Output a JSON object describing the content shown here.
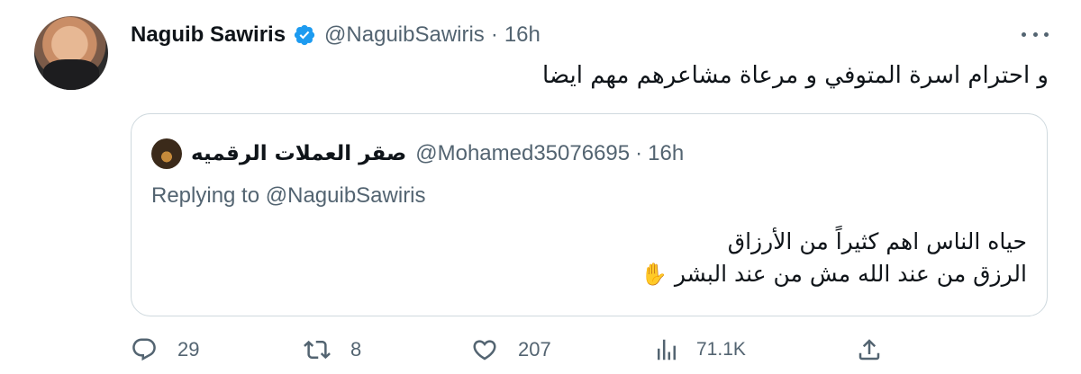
{
  "tweet": {
    "display_name": "Naguib Sawiris",
    "handle": "@NaguibSawiris",
    "separator": "·",
    "time": "16h",
    "text": "و احترام اسرة المتوفي و مرعاة مشاعرهم مهم ايضا"
  },
  "quoted": {
    "display_name": "صقر العملات الرقميه",
    "handle": "@Mohamed35076695",
    "separator": "·",
    "time": "16h",
    "replying_prefix": "Replying to ",
    "replying_to": "@NaguibSawiris",
    "line1": "حياه الناس اهم كثيراً من الأرزاق",
    "line2": "الرزق من عند الله مش من عند البشر",
    "emoji": "✋"
  },
  "actions": {
    "replies": "29",
    "retweets": "8",
    "likes": "207",
    "views": "71.1K"
  },
  "icons": {
    "verified": "verified-badge-icon",
    "more": "more-icon",
    "reply": "reply-icon",
    "retweet": "retweet-icon",
    "like": "heart-icon",
    "views": "views-icon",
    "share": "share-icon"
  },
  "colors": {
    "verified_blue": "#1d9bf0",
    "secondary_text": "#536471",
    "primary_text": "#0f1419",
    "border": "#cfd9de"
  }
}
